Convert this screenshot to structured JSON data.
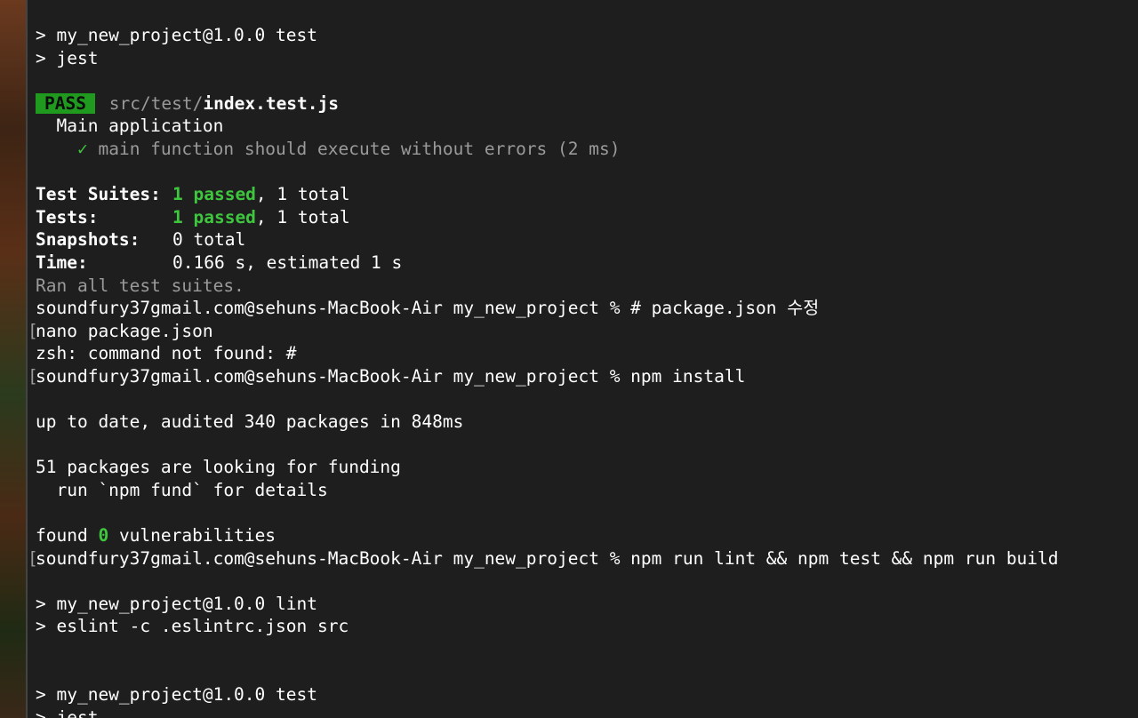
{
  "terminal": {
    "script_test_header": "> my_new_project@1.0.0 test",
    "script_test_cmd": "> jest",
    "pass_badge": "PASS",
    "test_path_dim": "src/test/",
    "test_file": "index.test.js",
    "describe_block": "Main application",
    "test_check": "✓",
    "test_case": "main function should execute without errors (2 ms)",
    "summary": {
      "suites_label": "Test Suites:",
      "suites_passed": "1 passed",
      "suites_total": ", 1 total",
      "tests_label": "Tests:",
      "tests_passed": "1 passed",
      "tests_total": ", 1 total",
      "snapshots_label": "Snapshots:",
      "snapshots_value": "0 total",
      "time_label": "Time:",
      "time_value": "0.166 s, estimated 1 s"
    },
    "ran_all": "Ran all test suites.",
    "prompt_1": "soundfury37gmail.com@sehuns-MacBook-Air my_new_project % # package.json 수정",
    "cmd_nano": "nano package.json",
    "zsh_error": "zsh: command not found: #",
    "prompt_2": "soundfury37gmail.com@sehuns-MacBook-Air my_new_project % npm install",
    "npm_up_to_date": "up to date, audited 340 packages in 848ms",
    "npm_funding": "51 packages are looking for funding",
    "npm_fund_hint": "  run `npm fund` for details",
    "found_prefix": "found ",
    "found_count": "0",
    "found_suffix": " vulnerabilities",
    "prompt_3": "soundfury37gmail.com@sehuns-MacBook-Air my_new_project % npm run lint && npm test && npm run build",
    "lint_header": "> my_new_project@1.0.0 lint",
    "lint_cmd": "> eslint -c .eslintrc.json src",
    "test_header_2": "> my_new_project@1.0.0 test",
    "test_cmd_2": "> jest",
    "bracket_char": "["
  }
}
